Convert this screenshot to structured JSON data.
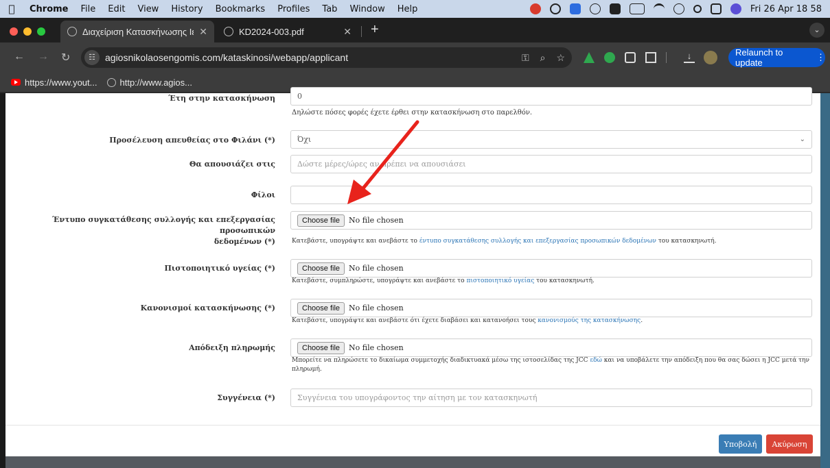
{
  "menubar": {
    "app_name": "Chrome",
    "items": [
      "File",
      "Edit",
      "View",
      "History",
      "Bookmarks",
      "Profiles",
      "Tab",
      "Window",
      "Help"
    ],
    "clock": "Fri 26 Apr  18 58"
  },
  "tabs": [
    {
      "title": "Διαχείριση Κατασκήνωσης Ιε",
      "active": true
    },
    {
      "title": "KD2024-003.pdf",
      "active": false
    }
  ],
  "toolbar": {
    "url": "agiosnikolaosengomis.com/kataskinosi/webapp/applicant",
    "relaunch_label": "Relaunch to update"
  },
  "bookmarks": [
    {
      "label": "https://www.yout...",
      "icon": "youtube-icon"
    },
    {
      "label": "http://www.agios...",
      "icon": "globe-icon"
    }
  ],
  "form": {
    "years": {
      "label": "Έτη στην κατασκήνωση",
      "value": "0",
      "help": "Δηλώστε πόσες φορές έχετε έρθει στην κατασκήνωση στο παρελθόν."
    },
    "direct_arrival": {
      "label": "Προσέλευση απευθείας στο Φιλάνι (*)",
      "value": "Όχι"
    },
    "absent": {
      "label": "Θα απουσιάζει στις",
      "placeholder": "Δώστε μέρες/ώρες αν πρέπει να απουσιάσει"
    },
    "friends": {
      "label": "Φίλοι",
      "value": ""
    },
    "consent": {
      "label_line1": "Έντυπο συγκατάθεσης συλλογής και επεξεργασίας προσωπικών",
      "label_line2": "δεδομένων (*)",
      "help_pre": "Κατεβάστε, υπογράψτε και ανεβάστε το",
      "help_link": "έντυπο συγκατάθεσης συλλογής και επεξεργασίας προσωπικών δεδομένων",
      "help_post": "του κατασκηνωτή."
    },
    "health": {
      "label": "Πιστοποιητικό υγείας (*)",
      "help_pre": "Κατεβάστε, συμπληρώστε, υπογράψτε και ανεβάστε το",
      "help_link": "πιστοποιητικό υγείας",
      "help_post": "του κατασκηνωτή."
    },
    "rules": {
      "label": "Κανονισμοί κατασκήνωσης (*)",
      "help_pre": "Κατεβάστε, υπογράψτε και ανεβάστε ότι έχετε διαβάσει και κατανοήσει τους",
      "help_link": "κανονισμούς της κατασκήνωσης",
      "help_post": "."
    },
    "payment": {
      "label": "Απόδειξη πληρωμής",
      "help_pre": "Μπορείτε να πληρώσετε το δικαίωμα συμμετοχής διαδικτυακά μέσω της ιστοσελίδας της JCC",
      "help_link": "εδώ",
      "help_post": "και να υποβάλετε την απόδειξη που θα σας δώσει η JCC μετά την πληρωμή."
    },
    "relation": {
      "label": "Συγγένεια (*)",
      "placeholder": "Συγγένεια του υπογράφοντος την αίτηση με τον κατασκηνωτή"
    },
    "file_button": "Choose file",
    "no_file": "No file chosen",
    "submit": "Υποβολή",
    "cancel": "Ακύρωση"
  },
  "colors": {
    "submit": "#3a7db5",
    "cancel": "#d94436",
    "link": "#2a74b5",
    "relaunch": "#0b57d0",
    "arrow": "#e8231c"
  }
}
